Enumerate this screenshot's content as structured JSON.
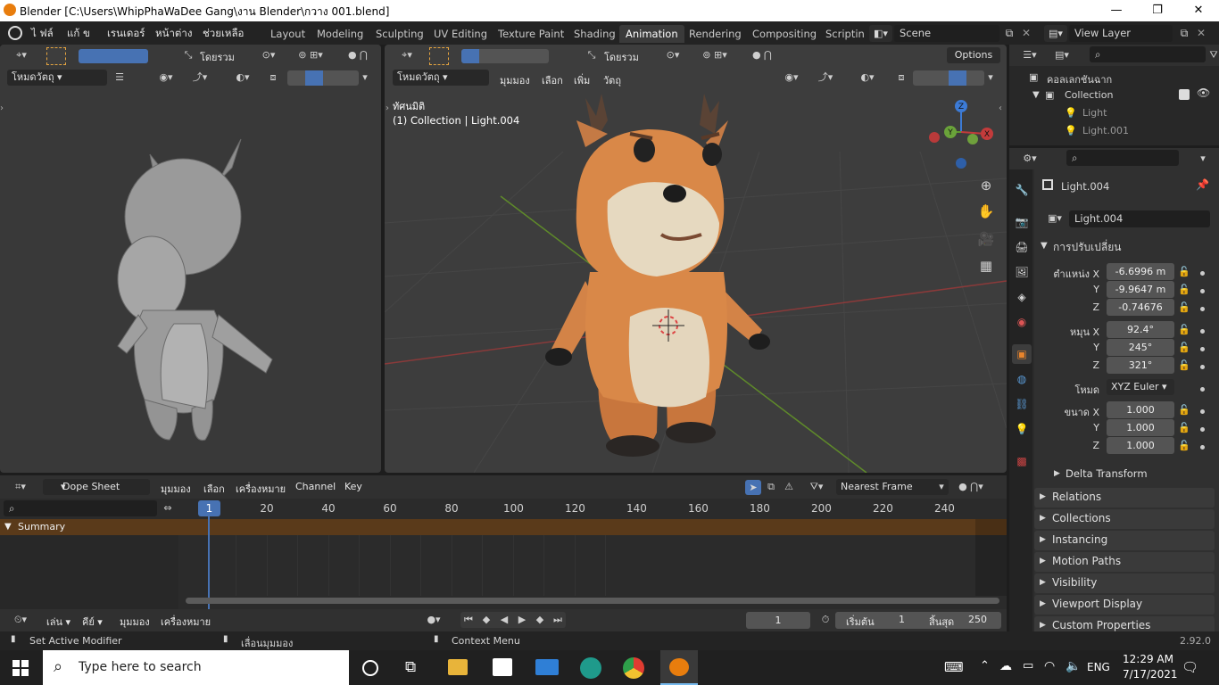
{
  "window": {
    "title": "Blender [C:\\Users\\WhipPhaWaDee Gang\\งาน Blender\\กวาง 001.blend]",
    "minimize": "—",
    "maximize": "❐",
    "close": "✕"
  },
  "menu": {
    "file": "ไ ฟล์",
    "edit": "แก้ ข",
    "render": "เรนเดอร์",
    "window": "หน้าต่าง",
    "help": "ช่วยเหลือ"
  },
  "workspaces": [
    "Layout",
    "Modeling",
    "Sculpting",
    "UV Editing",
    "Texture Paint",
    "Shading",
    "Animation",
    "Rendering",
    "Compositing",
    "Scriptin"
  ],
  "scene": {
    "label": "Scene",
    "view_layer": "View Layer"
  },
  "left_viewport": {
    "orientation": "โดยรวม",
    "mode": "โหมดวัตถุ"
  },
  "main_viewport": {
    "orientation": "โดยรวม",
    "mode": "โหมดวัตถุ",
    "menu_view": "มุมมอง",
    "menu_select": "เลือก",
    "menu_add": "เพิ่ม",
    "menu_object": "วัตถุ",
    "options": "Options",
    "overlay_title": "ทัศนมิติ",
    "overlay_sub": "(1) Collection | Light.004"
  },
  "outliner": {
    "root": "คอลเลกชันฉาก",
    "collection": "Collection",
    "items": [
      "Light",
      "Light.001"
    ]
  },
  "properties": {
    "object_name": "Light.004",
    "datablock": "Light.004",
    "section": "การปรับเปลี่ยน",
    "location_label": "ตำแหน่ง X",
    "rot_label": "หมุน X",
    "mode_label": "โหมด",
    "scale_label": "ขนาด X",
    "axis_y": "Y",
    "axis_z": "Z",
    "location": [
      "-6.6996 m",
      "-9.9647 m",
      "-0.74676"
    ],
    "rotation": [
      "92.4°",
      "245°",
      "321°"
    ],
    "rotation_mode": "XYZ Euler",
    "scale": [
      "1.000",
      "1.000",
      "1.000"
    ],
    "delta": "Delta Transform",
    "panels": [
      "Relations",
      "Collections",
      "Instancing",
      "Motion Paths",
      "Visibility",
      "Viewport Display",
      "Custom Properties"
    ]
  },
  "dopesheet": {
    "mode": "Dope Sheet",
    "menu_view": "มุมมอง",
    "menu_select": "เลือก",
    "menu_marker": "เครื่องหมาย",
    "menu_channel": "Channel",
    "menu_key": "Key",
    "snap": "Nearest Frame",
    "summary": "Summary",
    "current_frame_badge": "1",
    "ticks": [
      "20",
      "40",
      "60",
      "80",
      "100",
      "120",
      "140",
      "160",
      "180",
      "200",
      "220",
      "240"
    ]
  },
  "timeline": {
    "menu_play": "เล่น",
    "menu_key": "คีย์",
    "menu_view": "มุมมอง",
    "menu_marker": "เครื่องหมาย",
    "current_frame": "1",
    "start_label": "เริ่มต้น",
    "start": "1",
    "end_label": "สิ้นสุด",
    "end": "250"
  },
  "status": {
    "left": "Set Active Modifier",
    "middle": "เลื่อนมุมมอง",
    "right": "Context Menu",
    "version": "2.92.0"
  },
  "taskbar": {
    "search": "Type here to search",
    "lang": "ENG",
    "time": "12:29 AM",
    "date": "7/17/2021"
  }
}
